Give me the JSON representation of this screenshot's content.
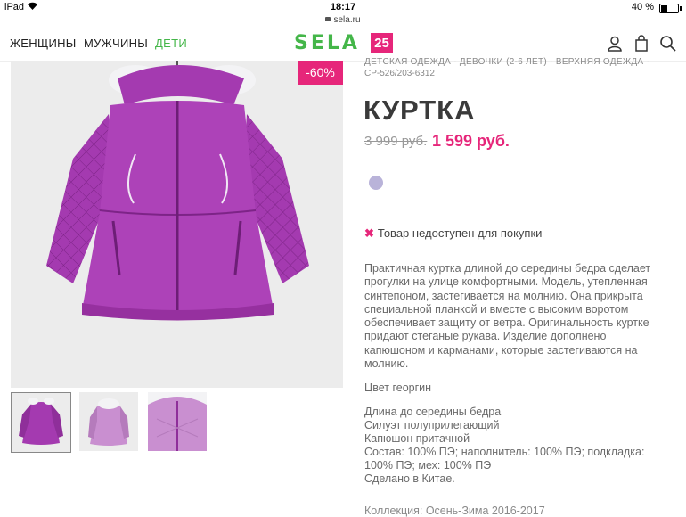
{
  "status_bar": {
    "device": "iPad",
    "time": "18:17",
    "battery": "40 %",
    "url": "sela.ru"
  },
  "nav": {
    "women": "ЖЕНЩИНЫ",
    "men": "МУЖЧИНЫ",
    "kids": "ДЕТИ"
  },
  "logo": {
    "text": "SELA",
    "badge": "25"
  },
  "product": {
    "discount": "-60%",
    "breadcrumb": "ДЕТСКАЯ ОДЕЖДА  ·  ДЕВОЧКИ (2-6 ЛЕТ)  ·  ВЕРХНЯЯ ОДЕЖДА  ·",
    "sku": "CP-526/203-6312",
    "title": "КУРТКА",
    "price_old": "3 999 руб.",
    "price_new": "1 599 руб.",
    "unavailable": "Товар недоступен для покупки",
    "description": "Практичная куртка длиной до середины бедра сделает прогулки на улице комфортными. Модель, утепленная синтепоном, застегивается на молнию. Она прикрыта специальной планкой и вместе с высоким воротом обеспечивает защиту от ветра. Оригинальность куртке придают стеганые рукава. Изделие дополнено капюшоном и карманами, которые застегиваются на молнию.",
    "color": "Цвет георгин",
    "specs": [
      "Длина до середины бедра",
      "Силуэт полуприлегающий",
      "Капюшон притачной",
      "Состав: 100% ПЭ; наполнитель: 100% ПЭ; подкладка: 100% ПЭ; мех: 100% ПЭ",
      "Сделано в Китае."
    ],
    "collection": "Коллекция: Осень-Зима 2016-2017"
  },
  "colors": {
    "accent_green": "#44b649",
    "accent_pink": "#e6267a",
    "jacket_purple": "#a43ab0",
    "swatch": "#b9b3d9"
  }
}
